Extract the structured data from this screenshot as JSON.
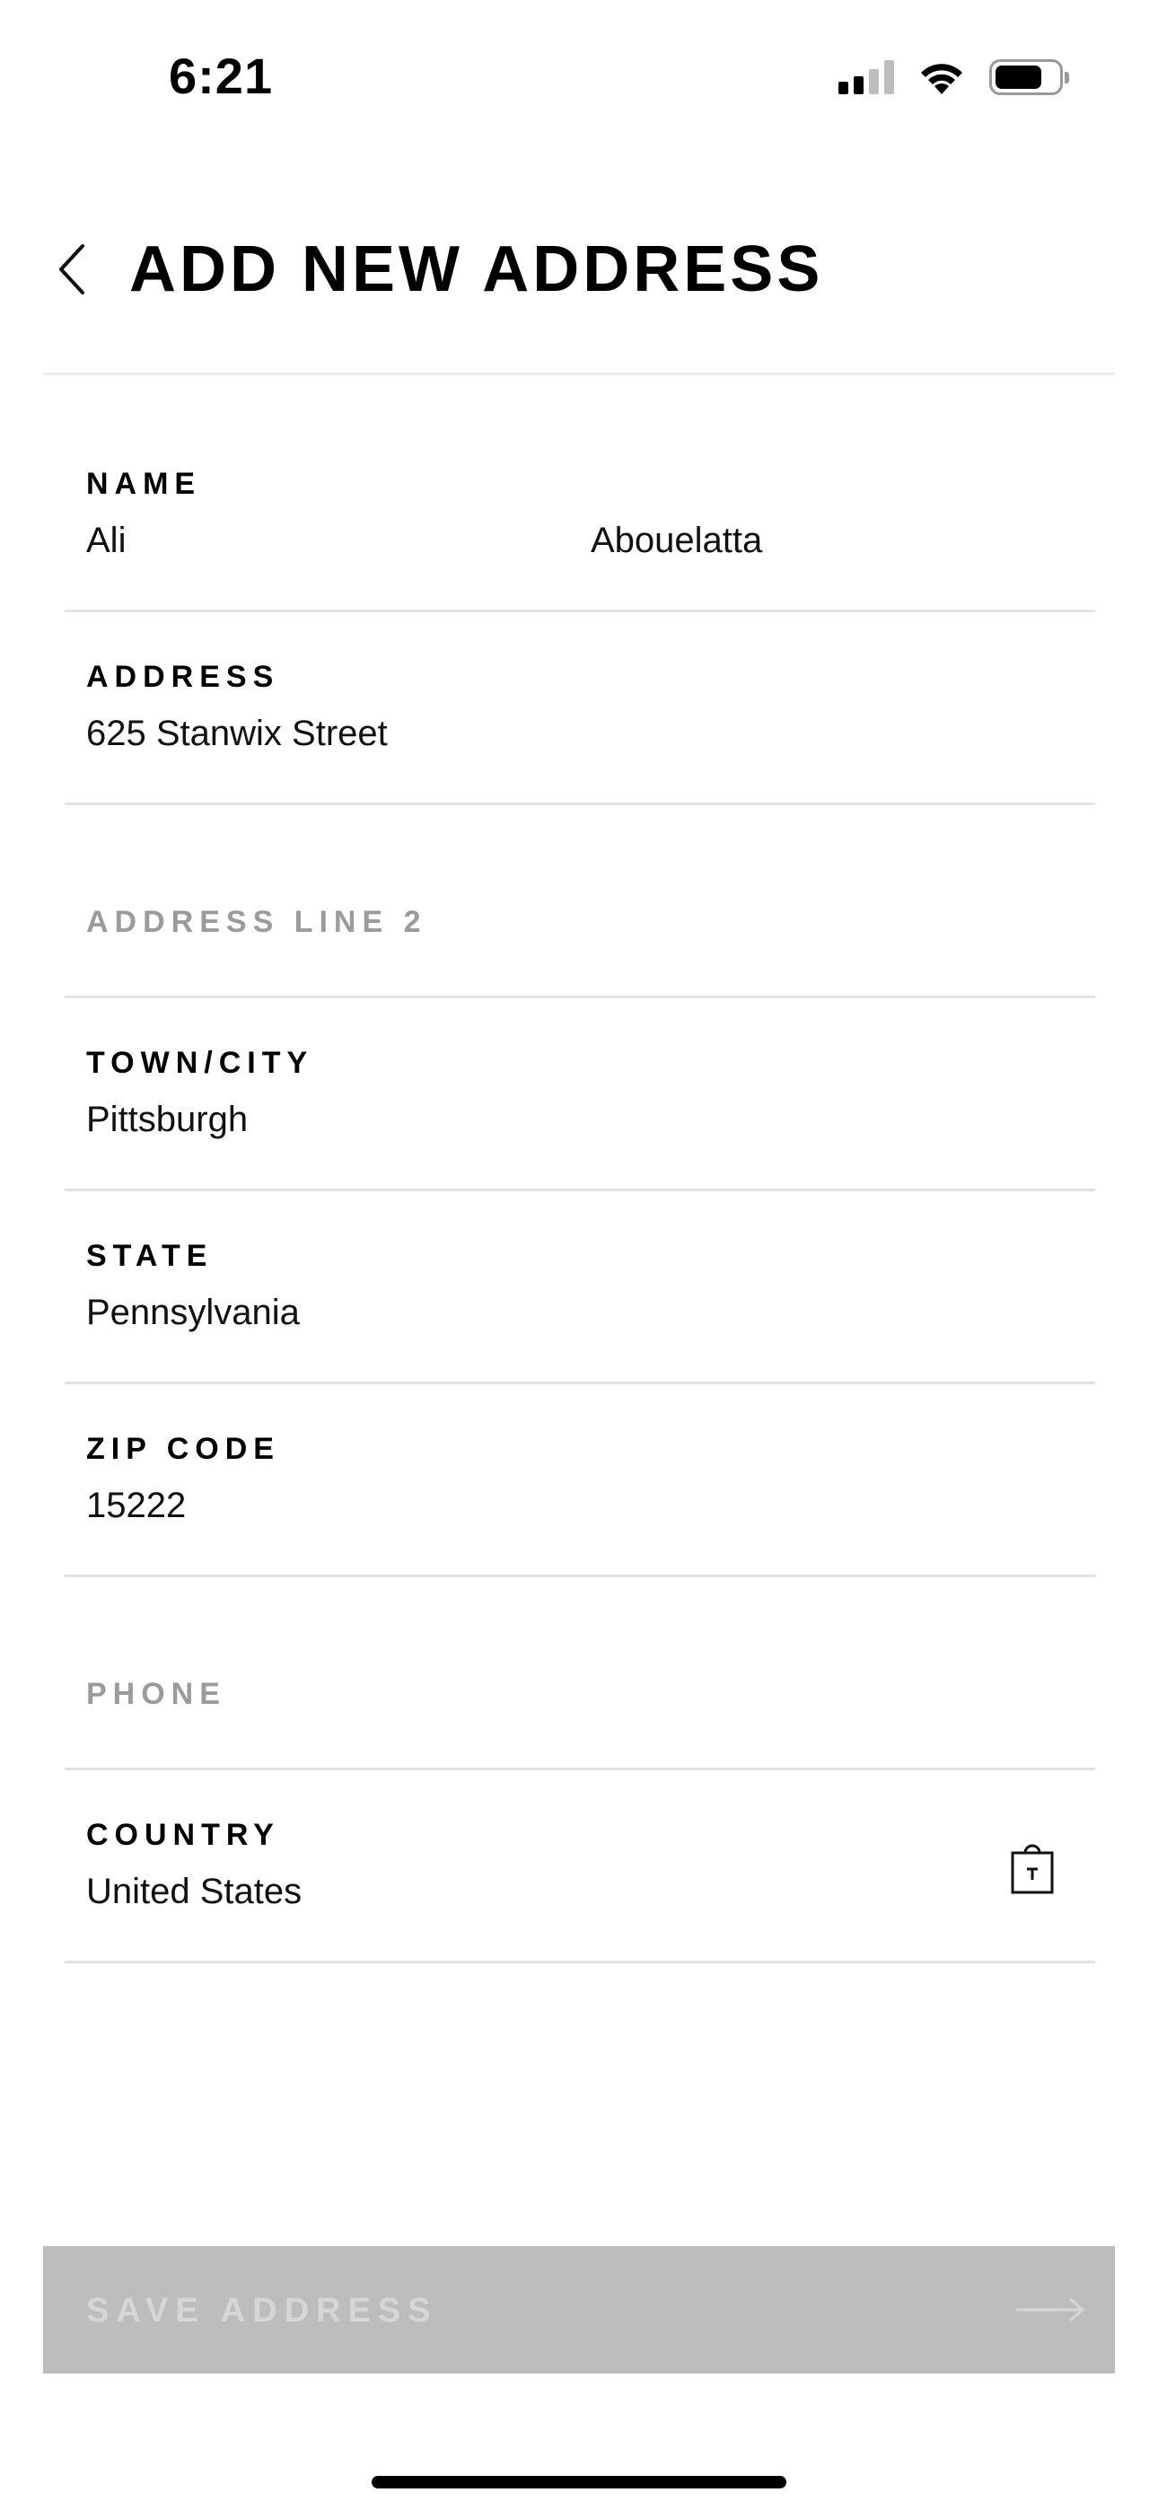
{
  "status_bar": {
    "time": "6:21",
    "battery_level": 0.75
  },
  "header": {
    "title": "ADD NEW ADDRESS",
    "back_icon": "chevron-left-icon"
  },
  "form": {
    "name": {
      "label": "NAME",
      "first_name": "Ali",
      "last_name": "Abouelatta"
    },
    "address": {
      "label": "ADDRESS",
      "value": "625 Stanwix Street"
    },
    "address_line_2": {
      "label": "ADDRESS LINE 2",
      "value": ""
    },
    "town_city": {
      "label": "TOWN/CITY",
      "value": "Pittsburgh"
    },
    "state": {
      "label": "STATE",
      "value": "Pennsylvania"
    },
    "zip_code": {
      "label": "ZIP CODE",
      "value": "15222"
    },
    "phone": {
      "label": "PHONE",
      "value": ""
    },
    "country": {
      "label": "COUNTRY",
      "value": "United States",
      "icon": "shopping-bag-icon"
    }
  },
  "save_button": {
    "label": "SAVE ADDRESS",
    "icon": "arrow-right-icon",
    "enabled": false
  },
  "colors": {
    "text": "#000000",
    "placeholder": "#9b9b9b",
    "divider": "#e3e3e3",
    "button_disabled_bg": "#bdbdbd",
    "button_disabled_text": "#d6d6d6"
  }
}
